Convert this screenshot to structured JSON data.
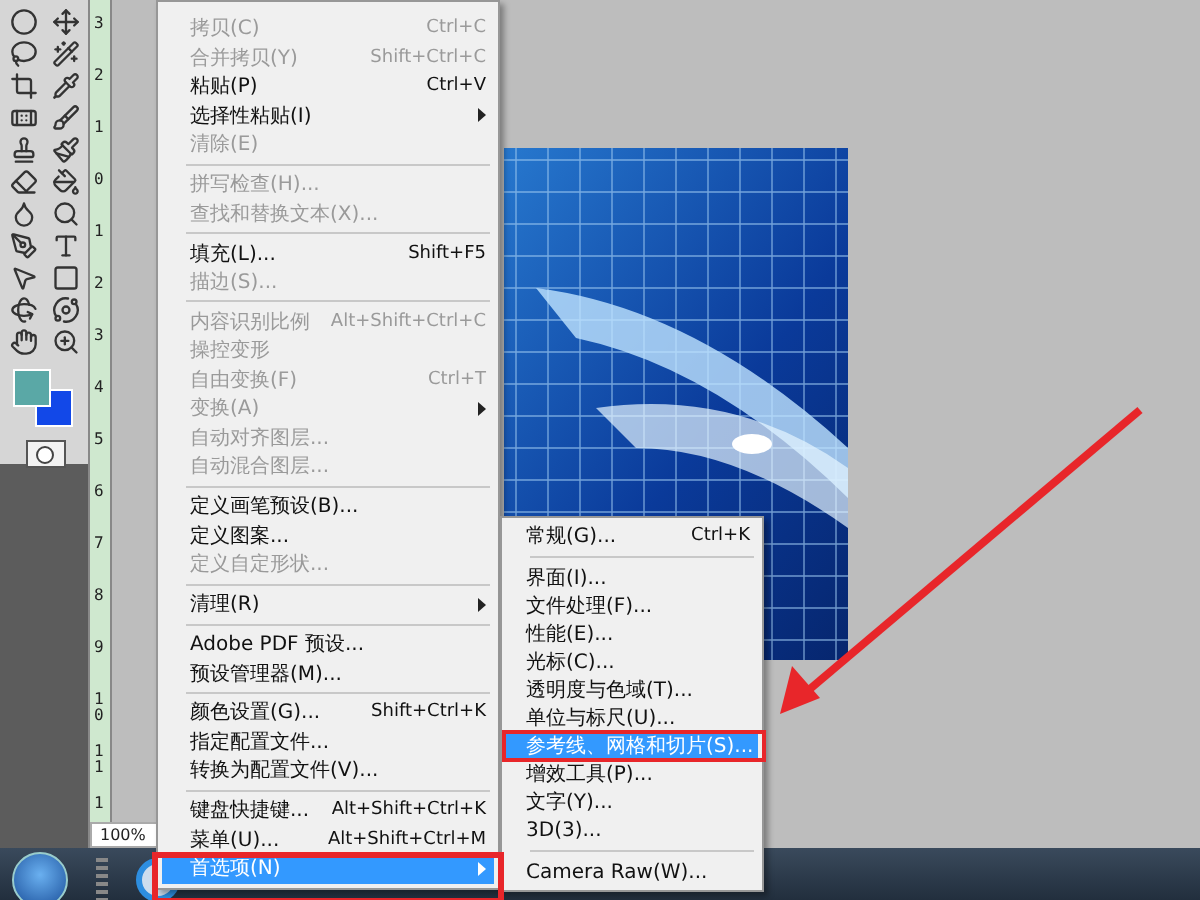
{
  "ruler": {
    "marks": [
      "3",
      "2",
      "1",
      "0",
      "1",
      "2",
      "3",
      "4",
      "5",
      "6",
      "7",
      "8",
      "9",
      "10",
      "11",
      "1"
    ]
  },
  "status": {
    "zoom": "100%"
  },
  "edit_menu": {
    "items": [
      {
        "kind": "item",
        "label": "拷贝(C)",
        "shortcut": "Ctrl+C",
        "disabled": true,
        "has_submenu": false,
        "selected": false
      },
      {
        "kind": "item",
        "label": "合并拷贝(Y)",
        "shortcut": "Shift+Ctrl+C",
        "disabled": true,
        "has_submenu": false,
        "selected": false
      },
      {
        "kind": "item",
        "label": "粘贴(P)",
        "shortcut": "Ctrl+V",
        "disabled": false,
        "has_submenu": false,
        "selected": false
      },
      {
        "kind": "item",
        "label": "选择性粘贴(I)",
        "disabled": false,
        "has_submenu": true,
        "selected": false
      },
      {
        "kind": "item",
        "label": "清除(E)",
        "disabled": true,
        "has_submenu": false,
        "selected": false
      },
      {
        "kind": "separator"
      },
      {
        "kind": "item",
        "label": "拼写检查(H)...",
        "disabled": true,
        "has_submenu": false,
        "selected": false
      },
      {
        "kind": "item",
        "label": "查找和替换文本(X)...",
        "disabled": true,
        "has_submenu": false,
        "selected": false
      },
      {
        "kind": "separator"
      },
      {
        "kind": "item",
        "label": "填充(L)...",
        "shortcut": "Shift+F5",
        "disabled": false,
        "has_submenu": false,
        "selected": false
      },
      {
        "kind": "item",
        "label": "描边(S)...",
        "disabled": true,
        "has_submenu": false,
        "selected": false
      },
      {
        "kind": "separator"
      },
      {
        "kind": "item",
        "label": "内容识别比例",
        "shortcut": "Alt+Shift+Ctrl+C",
        "disabled": true,
        "has_submenu": false,
        "selected": false
      },
      {
        "kind": "item",
        "label": "操控变形",
        "disabled": true,
        "has_submenu": false,
        "selected": false
      },
      {
        "kind": "item",
        "label": "自由变换(F)",
        "shortcut": "Ctrl+T",
        "disabled": true,
        "has_submenu": false,
        "selected": false
      },
      {
        "kind": "item",
        "label": "变换(A)",
        "disabled": true,
        "has_submenu": true,
        "selected": false
      },
      {
        "kind": "item",
        "label": "自动对齐图层...",
        "disabled": true,
        "has_submenu": false,
        "selected": false
      },
      {
        "kind": "item",
        "label": "自动混合图层...",
        "disabled": true,
        "has_submenu": false,
        "selected": false
      },
      {
        "kind": "separator"
      },
      {
        "kind": "item",
        "label": "定义画笔预设(B)...",
        "disabled": false,
        "has_submenu": false,
        "selected": false
      },
      {
        "kind": "item",
        "label": "定义图案...",
        "disabled": false,
        "has_submenu": false,
        "selected": false
      },
      {
        "kind": "item",
        "label": "定义自定形状...",
        "disabled": true,
        "has_submenu": false,
        "selected": false
      },
      {
        "kind": "separator"
      },
      {
        "kind": "item",
        "label": "清理(R)",
        "disabled": false,
        "has_submenu": true,
        "selected": false
      },
      {
        "kind": "separator"
      },
      {
        "kind": "item",
        "label": "Adobe PDF 预设...",
        "disabled": false,
        "has_submenu": false,
        "selected": false
      },
      {
        "kind": "item",
        "label": "预设管理器(M)...",
        "disabled": false,
        "has_submenu": false,
        "selected": false
      },
      {
        "kind": "separator"
      },
      {
        "kind": "item",
        "label": "颜色设置(G)...",
        "shortcut": "Shift+Ctrl+K",
        "disabled": false,
        "has_submenu": false,
        "selected": false
      },
      {
        "kind": "item",
        "label": "指定配置文件...",
        "disabled": false,
        "has_submenu": false,
        "selected": false
      },
      {
        "kind": "item",
        "label": "转换为配置文件(V)...",
        "disabled": false,
        "has_submenu": false,
        "selected": false
      },
      {
        "kind": "separator"
      },
      {
        "kind": "item",
        "label": "键盘快捷键...",
        "shortcut": "Alt+Shift+Ctrl+K",
        "disabled": false,
        "has_submenu": false,
        "selected": false
      },
      {
        "kind": "item",
        "label": "菜单(U)...",
        "shortcut": "Alt+Shift+Ctrl+M",
        "disabled": false,
        "has_submenu": false,
        "selected": false
      },
      {
        "kind": "item",
        "label": "首选项(N)",
        "disabled": false,
        "has_submenu": true,
        "selected": true
      }
    ]
  },
  "preferences_submenu": {
    "items": [
      {
        "kind": "item",
        "label": "常规(G)...",
        "shortcut": "Ctrl+K",
        "selected": false
      },
      {
        "kind": "separator"
      },
      {
        "kind": "item",
        "label": "界面(I)...",
        "selected": false
      },
      {
        "kind": "item",
        "label": "文件处理(F)...",
        "selected": false
      },
      {
        "kind": "item",
        "label": "性能(E)...",
        "selected": false
      },
      {
        "kind": "item",
        "label": "光标(C)...",
        "selected": false
      },
      {
        "kind": "item",
        "label": "透明度与色域(T)...",
        "selected": false
      },
      {
        "kind": "item",
        "label": "单位与标尺(U)...",
        "selected": false
      },
      {
        "kind": "item",
        "label": "参考线、网格和切片(S)...",
        "selected": true
      },
      {
        "kind": "item",
        "label": "增效工具(P)...",
        "selected": false
      },
      {
        "kind": "item",
        "label": "文字(Y)...",
        "selected": false
      },
      {
        "kind": "item",
        "label": "3D(3)...",
        "selected": false
      },
      {
        "kind": "separator"
      },
      {
        "kind": "item",
        "label": "Camera Raw(W)...",
        "selected": false
      }
    ]
  }
}
